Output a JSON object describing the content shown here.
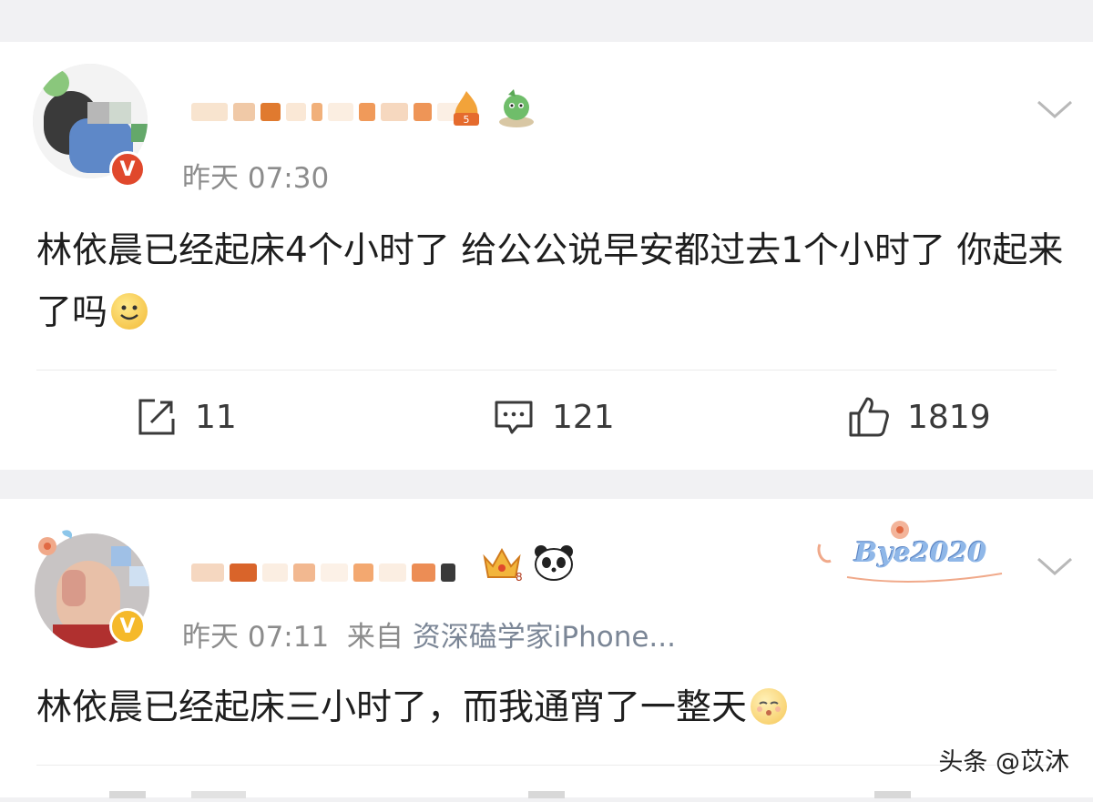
{
  "posts": [
    {
      "time": "昨天 07:30",
      "source_prefix": "",
      "source": "",
      "content": "林依晨已经起床4个小时了 给公公说早安都过去1个小时了 你起来了吗",
      "actions": {
        "repost": "11",
        "comment": "121",
        "like": "1819"
      }
    },
    {
      "time": "昨天 07:11",
      "source_prefix": "来自",
      "source": "资深磕学家iPhone...",
      "content": "林依晨已经起床三小时了，而我通宵了一整天",
      "badge_text": "Bye2020"
    }
  ],
  "watermark": "头条 @苡沐",
  "colors": {
    "verified_red": "#e0482c",
    "verified_gold": "#f5b92a",
    "meta_gray": "#8c8c8c",
    "source_blue": "#7b8696"
  },
  "icons": [
    "chevron-down-icon",
    "repost-icon",
    "comment-icon",
    "like-icon",
    "smile-emoji-icon"
  ]
}
